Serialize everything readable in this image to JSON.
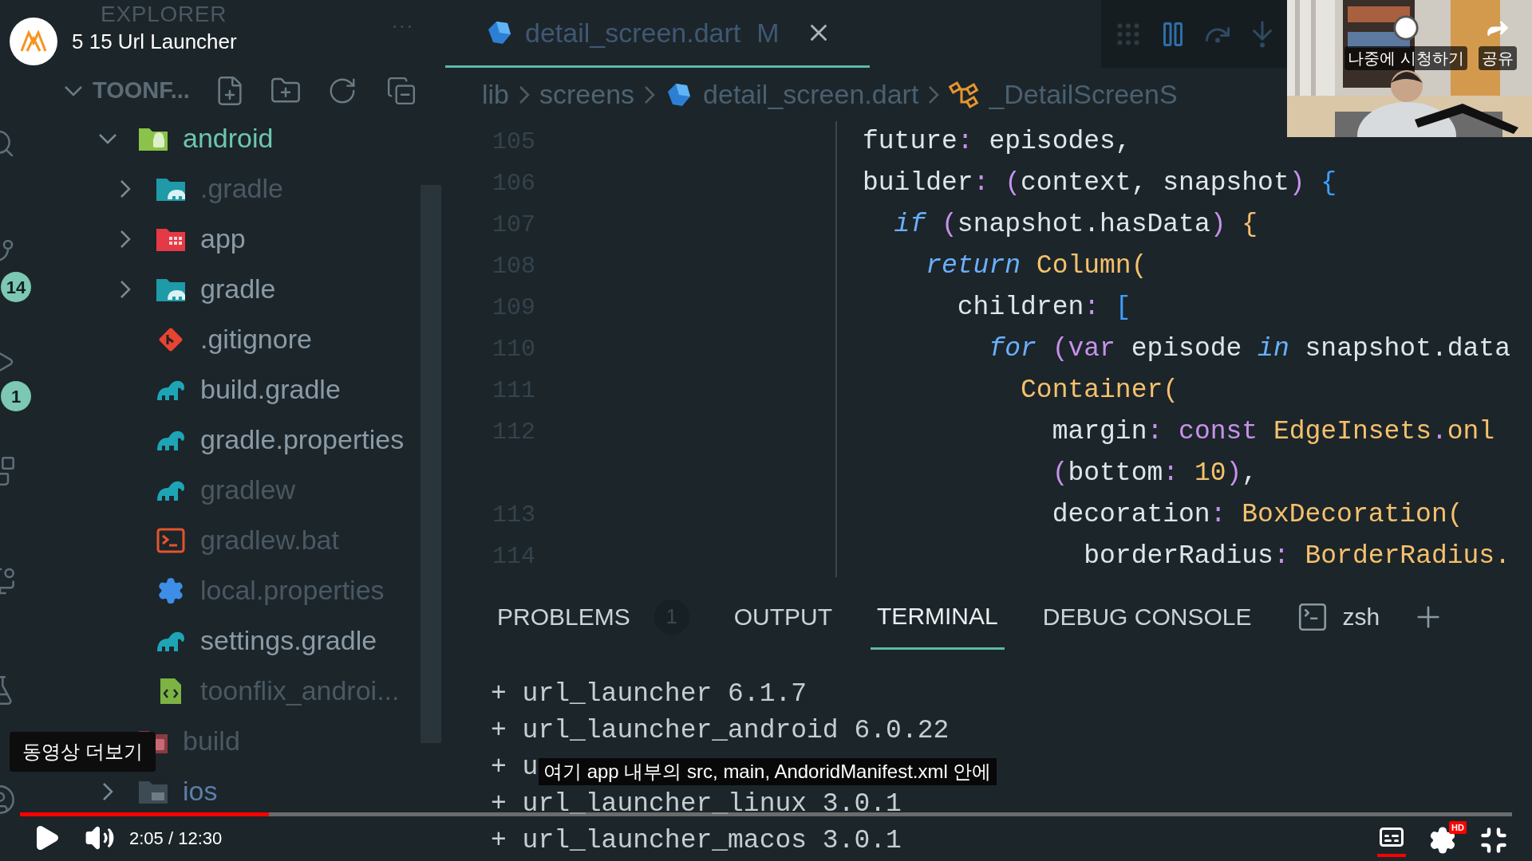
{
  "video": {
    "title": "5 15 Url Launcher",
    "watch_later": "나중에 시청하기",
    "share": "공유",
    "more_videos": "동영상 더보기",
    "subtitle": "여기 app 내부의 src, main, AndoridManifest.xml 안에",
    "progress": {
      "level": 0.167
    },
    "time": "2:05 / 12:30",
    "captions_on": true,
    "quality_badge": "HD"
  },
  "activity_bar": [
    {
      "kind": "search"
    },
    {
      "kind": "source_control",
      "badge": "14"
    },
    {
      "kind": "run",
      "badge": "1"
    },
    {
      "kind": "extensions"
    },
    {
      "kind": "remote"
    },
    {
      "kind": "testing"
    },
    {
      "kind": "account"
    }
  ],
  "explorer": {
    "title": "EXPLORER",
    "more": "···",
    "root": {
      "label": "TOONF...",
      "expanded": true
    },
    "tree": [
      {
        "label": "android",
        "kind": "folder_android",
        "expanded": true,
        "ignored": false,
        "children": [
          {
            "label": ".gradle",
            "kind": "folder_gradle",
            "expanded": false,
            "ignored": true
          },
          {
            "label": "app",
            "kind": "folder_app",
            "expanded": false,
            "ignored": false
          },
          {
            "label": "gradle",
            "kind": "folder_gradle",
            "expanded": false,
            "ignored": false
          },
          {
            "label": ".gitignore",
            "kind": "git",
            "ignored": false
          },
          {
            "label": "build.gradle",
            "kind": "gradle",
            "ignored": false
          },
          {
            "label": "gradle.properties",
            "kind": "gradle",
            "ignored": false
          },
          {
            "label": "gradlew",
            "kind": "gradle",
            "ignored": true
          },
          {
            "label": "gradlew.bat",
            "kind": "terminal",
            "ignored": true
          },
          {
            "label": "local.properties",
            "kind": "gear",
            "ignored": true
          },
          {
            "label": "settings.gradle",
            "kind": "gradle",
            "ignored": false
          },
          {
            "label": "toonflix_androi...",
            "kind": "xml",
            "ignored": true
          }
        ]
      },
      {
        "label": "build",
        "kind": "folder_build",
        "ignored": true
      },
      {
        "label": "ios",
        "kind": "folder_ios",
        "expanded": false,
        "ignored": false
      }
    ]
  },
  "editor": {
    "tab": {
      "label": "detail_screen.dart",
      "status": "M",
      "selected": true
    },
    "breadcrumb": [
      {
        "label": "lib",
        "kind": "folder"
      },
      {
        "label": "screens",
        "kind": "folder"
      },
      {
        "label": "detail_screen.dart",
        "kind": "dart"
      },
      {
        "label": "_DetailScreenS",
        "kind": "class"
      }
    ],
    "lines": [
      {
        "number": "105",
        "code": [
          {
            "text": "future",
            "kind": "prop"
          },
          {
            "text": ":",
            "kind": "punct"
          },
          {
            "text": " episodes,",
            "kind": "text"
          }
        ]
      },
      {
        "number": "106",
        "code": [
          {
            "text": "builder",
            "kind": "prop"
          },
          {
            "text": ":",
            "kind": "punct"
          },
          {
            "text": " (",
            "kind": "paren"
          },
          {
            "text": "context, snapshot",
            "kind": "text"
          },
          {
            "text": ")",
            "kind": "paren"
          },
          {
            "text": " {",
            "kind": "brace"
          }
        ]
      },
      {
        "number": "107",
        "code": [
          {
            "text": "  if",
            "kind": "keyword"
          },
          {
            "text": " (",
            "kind": "paren"
          },
          {
            "text": "snapshot.hasData",
            "kind": "text"
          },
          {
            "text": ")",
            "kind": "paren"
          },
          {
            "text": " {",
            "kind": "type"
          }
        ]
      },
      {
        "number": "108",
        "code": [
          {
            "text": "    return",
            "kind": "keyword"
          },
          {
            "text": " Column",
            "kind": "type"
          },
          {
            "text": "(",
            "kind": "type"
          }
        ]
      },
      {
        "number": "109",
        "code": [
          {
            "text": "      children",
            "kind": "prop"
          },
          {
            "text": ":",
            "kind": "punct"
          },
          {
            "text": " [",
            "kind": "brace"
          }
        ]
      },
      {
        "number": "110",
        "code": [
          {
            "text": "        for",
            "kind": "keyword"
          },
          {
            "text": " (",
            "kind": "paren"
          },
          {
            "text": "var",
            "kind": "storage"
          },
          {
            "text": " episode ",
            "kind": "text"
          },
          {
            "text": "in",
            "kind": "keyword"
          },
          {
            "text": " snapshot.data",
            "kind": "text"
          }
        ]
      },
      {
        "number": "111",
        "code": [
          {
            "text": "          Container",
            "kind": "type"
          },
          {
            "text": "(",
            "kind": "type"
          }
        ]
      },
      {
        "number": "112",
        "code": [
          {
            "text": "            margin",
            "kind": "prop"
          },
          {
            "text": ":",
            "kind": "punct"
          },
          {
            "text": " const",
            "kind": "storage"
          },
          {
            "text": " EdgeInsets",
            "kind": "type"
          },
          {
            "text": ".",
            "kind": "punct"
          },
          {
            "text": "onl",
            "kind": "type"
          }
        ]
      },
      {
        "code": [
          {
            "text": "            (",
            "kind": "paren"
          },
          {
            "text": "bottom",
            "kind": "prop"
          },
          {
            "text": ":",
            "kind": "punct"
          },
          {
            "text": " 10",
            "kind": "number"
          },
          {
            "text": ")",
            "kind": "paren"
          },
          {
            "text": ",",
            "kind": "text"
          }
        ]
      },
      {
        "number": "113",
        "code": [
          {
            "text": "            decoration",
            "kind": "prop"
          },
          {
            "text": ":",
            "kind": "punct"
          },
          {
            "text": " BoxDecoration",
            "kind": "type"
          },
          {
            "text": "(",
            "kind": "type"
          }
        ]
      },
      {
        "number": "114",
        "code": [
          {
            "text": "              borderRadius",
            "kind": "prop"
          },
          {
            "text": ":",
            "kind": "punct"
          },
          {
            "text": " BorderRadius.",
            "kind": "type"
          }
        ]
      }
    ]
  },
  "panel": {
    "tabs": [
      {
        "label": "PROBLEMS",
        "count": "1",
        "selected": false
      },
      {
        "label": "OUTPUT",
        "selected": false
      },
      {
        "label": "TERMINAL",
        "selected": true
      },
      {
        "label": "DEBUG CONSOLE",
        "selected": false
      }
    ],
    "shell": "zsh",
    "terminal_lines": [
      "+ url_launcher 6.1.7",
      "+ url_launcher_android 6.0.22",
      "+ u",
      "+ url_launcher_linux 3.0.1",
      "+ url_launcher_macos 3.0.1"
    ]
  }
}
